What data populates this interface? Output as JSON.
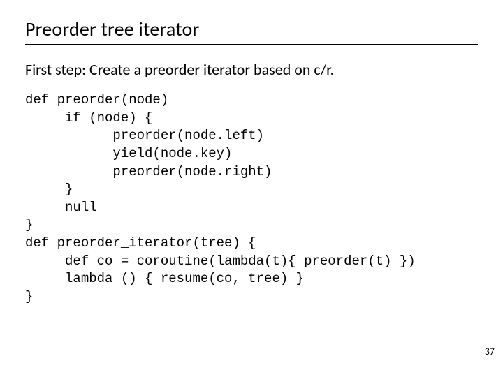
{
  "title": "Preorder tree iterator",
  "subtitle": "First step:  Create a preorder iterator based on c/r.",
  "code_lines": [
    "def preorder(node)",
    "     if (node) {",
    "           preorder(node.left)",
    "           yield(node.key)",
    "           preorder(node.right)",
    "     }",
    "     null",
    "}",
    "def preorder_iterator(tree) {",
    "     def co = coroutine(lambda(t){ preorder(t) })",
    "     lambda () { resume(co, tree) }",
    "}"
  ],
  "page_number": "37"
}
